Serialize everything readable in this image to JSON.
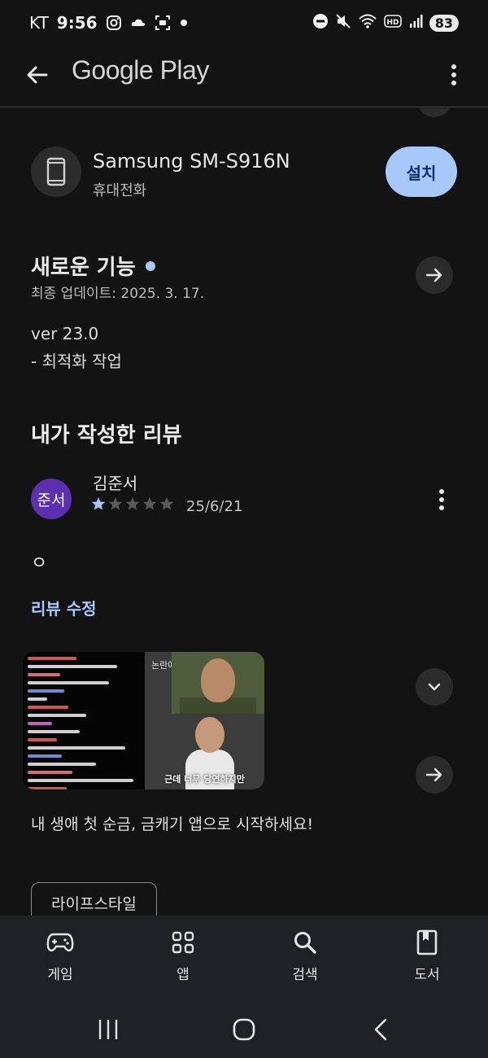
{
  "status_bar": {
    "carrier": "KT",
    "time": "9:56",
    "battery": "83"
  },
  "app_bar": {
    "title": "Google Play"
  },
  "device": {
    "name": "Samsung SM-S916N",
    "type": "휴대전화",
    "install_label": "설치"
  },
  "whats_new": {
    "title": "새로운 기능",
    "last_updated": "최종 업데이트: 2025. 3. 17.",
    "version": "ver 23.0",
    "note": "- 최적화 작업"
  },
  "my_review": {
    "title": "내가 작성한 리뷰",
    "avatar_text": "준서",
    "reviewer": "김준서",
    "rating": 1,
    "max_rating": 5,
    "date": "25/6/21",
    "text": "ㅇ",
    "edit_label": "리뷰 수정"
  },
  "promo": {
    "top_label": "논란에",
    "caption": "근데 너무 당연하지만",
    "text": "내 생애 첫 순금, 금캐기 앱으로 시작하세요!",
    "chip": "라이프스타일"
  },
  "bottom_nav": {
    "items": [
      {
        "label": "게임",
        "icon": "gamepad-icon"
      },
      {
        "label": "앱",
        "icon": "apps-grid-icon"
      },
      {
        "label": "검색",
        "icon": "search-icon"
      },
      {
        "label": "도서",
        "icon": "book-icon"
      }
    ]
  },
  "colors": {
    "background": "#131313",
    "accent": "#a8c7fa",
    "avatar": "#5b2fae",
    "star": "#a8c7fa"
  }
}
